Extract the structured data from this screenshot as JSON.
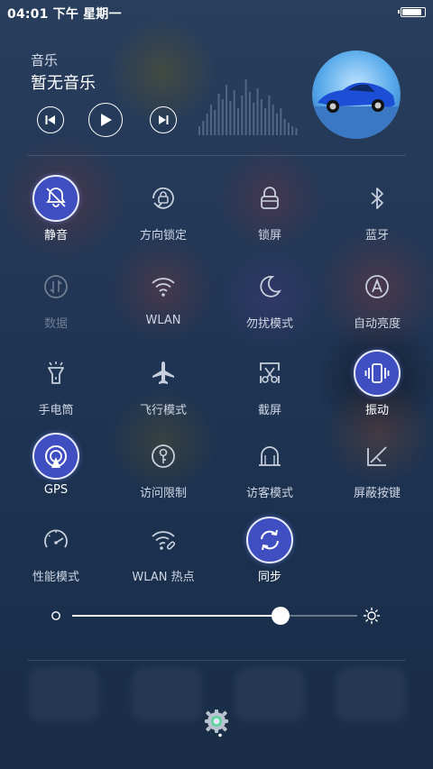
{
  "status": {
    "time": "04:01 下午 星期一",
    "battery_level": 0.92
  },
  "music": {
    "label": "音乐",
    "title": "暂无音乐",
    "controls": [
      "prev-icon",
      "play-icon",
      "next-icon"
    ]
  },
  "toggles": [
    {
      "label": "静音",
      "icon": "bell-off-icon",
      "on": true
    },
    {
      "label": "方向锁定",
      "icon": "rotation-lock-icon",
      "on": false
    },
    {
      "label": "锁屏",
      "icon": "lock-icon",
      "on": false
    },
    {
      "label": "蓝牙",
      "icon": "bluetooth-icon",
      "on": false
    },
    {
      "label": "数据",
      "icon": "mobile-data-icon",
      "on": false,
      "disabled": true
    },
    {
      "label": "WLAN",
      "icon": "wifi-icon",
      "on": false
    },
    {
      "label": "勿扰模式",
      "icon": "moon-icon",
      "on": false
    },
    {
      "label": "自动亮度",
      "icon": "auto-brightness-icon",
      "on": false
    },
    {
      "label": "手电筒",
      "icon": "flashlight-icon",
      "on": false
    },
    {
      "label": "飞行模式",
      "icon": "airplane-icon",
      "on": false
    },
    {
      "label": "截屏",
      "icon": "screenshot-icon",
      "on": false
    },
    {
      "label": "振动",
      "icon": "vibrate-icon",
      "on": true
    },
    {
      "label": "GPS",
      "icon": "gps-icon",
      "on": true
    },
    {
      "label": "访问限制",
      "icon": "access-restriction-icon",
      "on": false
    },
    {
      "label": "访客模式",
      "icon": "guest-mode-icon",
      "on": false
    },
    {
      "label": "屏蔽按键",
      "icon": "block-keys-icon",
      "on": false
    },
    {
      "label": "性能模式",
      "icon": "performance-icon",
      "on": false
    },
    {
      "label": "WLAN 热点",
      "icon": "hotspot-icon",
      "on": false
    },
    {
      "label": "同步",
      "icon": "sync-icon",
      "on": true
    }
  ],
  "brightness": {
    "value": 0.73,
    "min_icon": "brightness-low-icon",
    "max_icon": "brightness-high-icon"
  },
  "footer": {
    "icon": "settings-gear-icon"
  },
  "colors": {
    "accent": "#3f4ec0",
    "background": "#1f3553"
  }
}
